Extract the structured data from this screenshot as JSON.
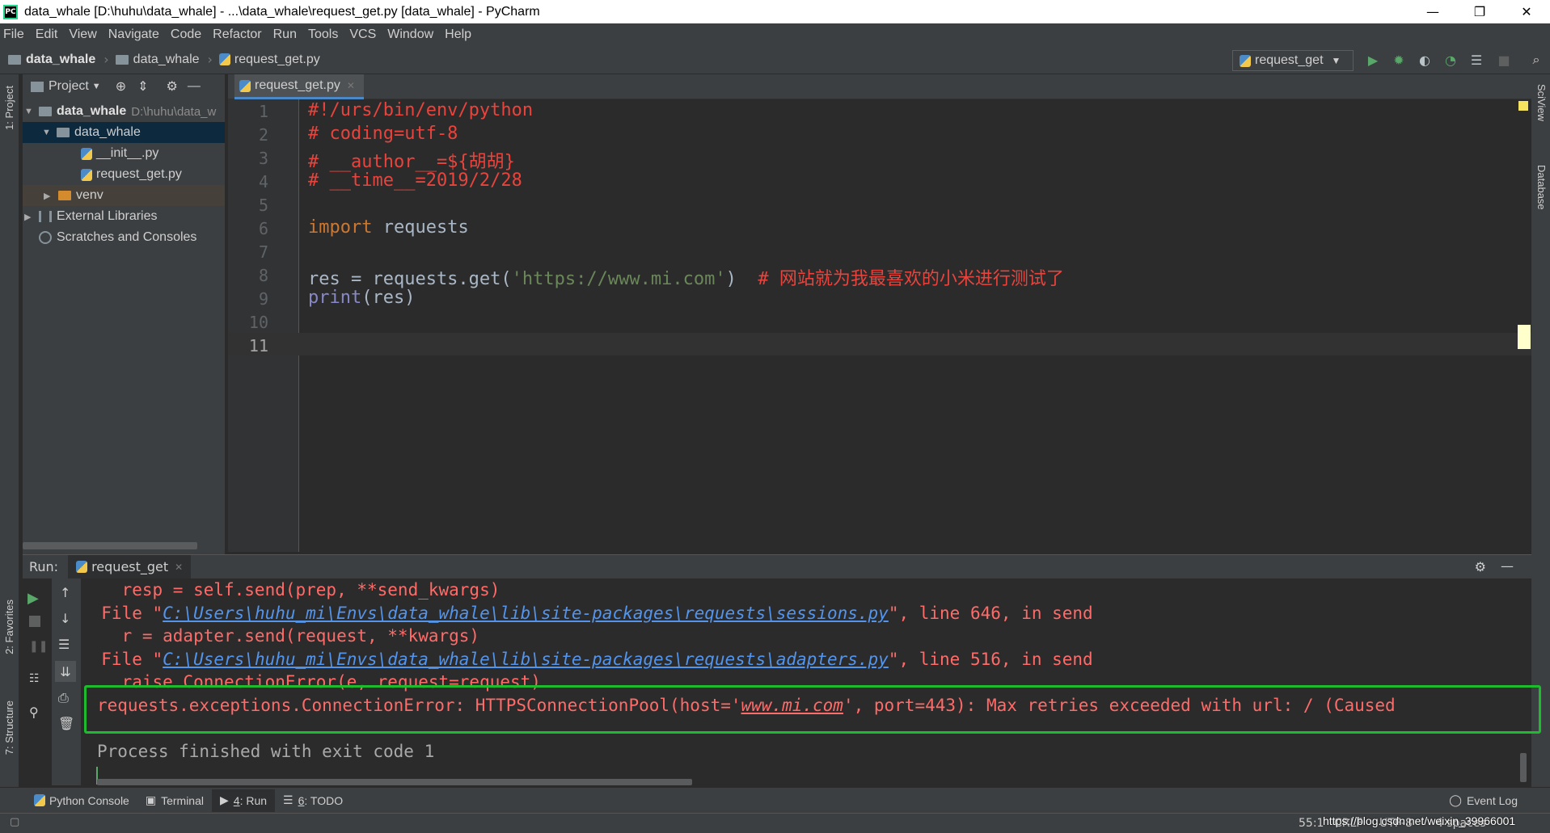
{
  "window": {
    "title": "data_whale [D:\\huhu\\data_whale] - ...\\data_whale\\request_get.py [data_whale] - PyCharm",
    "app_icon": "PC",
    "minimize": "—",
    "restore": "❐",
    "close": "✕"
  },
  "menu": [
    "File",
    "Edit",
    "View",
    "Navigate",
    "Code",
    "Refactor",
    "Run",
    "Tools",
    "VCS",
    "Window",
    "Help"
  ],
  "breadcrumb": {
    "root": "data_whale",
    "folder": "data_whale",
    "file": "request_get.py"
  },
  "toolbar": {
    "run_config": "request_get"
  },
  "left_strip": {
    "project": "1: Project",
    "favorites": "2: Favorites",
    "structure": "7: Structure"
  },
  "right_strip": {
    "sciview": "SciView",
    "database": "Database"
  },
  "project_panel": {
    "header": "Project",
    "tree": [
      {
        "label": "data_whale",
        "extra": "D:\\huhu\\data_w"
      },
      {
        "label": "data_whale"
      },
      {
        "label": "__init__.py"
      },
      {
        "label": "request_get.py"
      },
      {
        "label": "venv"
      },
      {
        "label": "External Libraries"
      },
      {
        "label": "Scratches and Consoles"
      }
    ]
  },
  "editor": {
    "tab": "request_get.py",
    "line_numbers": [
      "1",
      "2",
      "3",
      "4",
      "5",
      "6",
      "7",
      "8",
      "9",
      "10",
      "11"
    ],
    "code": {
      "l1": "#!/urs/bin/env/python",
      "l2": "# coding=utf-8",
      "l3": "# __author__=${胡胡}",
      "l4": "# __time__=2019/2/28",
      "l6_kw": "import",
      "l6_rest": " requests",
      "l8_a": "res = requests.get(",
      "l8_str": "'https://www.mi.com'",
      "l8_b": ")  ",
      "l8_comment": "# 网站就为我最喜欢的小米进行测试了",
      "l9_fn": "print",
      "l9_rest": "(res)"
    }
  },
  "run": {
    "label": "Run:",
    "tab": "request_get",
    "output": {
      "o1": "    resp = self.send(prep, **send_kwargs)",
      "o2_a": "  File \"",
      "o2_link": "C:\\Users\\huhu_mi\\Envs\\data_whale\\lib\\site-packages\\requests\\sessions.py",
      "o2_b": "\", line 646, in send",
      "o3": "    r = adapter.send(request, **kwargs)",
      "o4_a": "  File \"",
      "o4_link": "C:\\Users\\huhu_mi\\Envs\\data_whale\\lib\\site-packages\\requests\\adapters.py",
      "o4_b": "\", line 516, in send",
      "o5": "    raise ConnectionError(e, request=request)",
      "o6_a": "requests.exceptions.ConnectionError: HTTPSConnectionPool(host='",
      "o6_link": "www.mi.com",
      "o6_b": "', port=443): Max retries exceeded with url: / (Caused",
      "o7": "Process finished with exit code 1"
    }
  },
  "bottom_tabs": {
    "python_console": "Python Console",
    "terminal": "Terminal",
    "run_num": "4",
    "run": ": Run",
    "todo_num": "6",
    "todo": ": TODO",
    "event_log": "Event Log"
  },
  "status": {
    "position": "55:1",
    "line_sep": "CRLF",
    "encoding": "UTF-8",
    "indent": "4 spaces",
    "watermark": "https://blog.csdn.net/weixin_39966001"
  },
  "colors": {
    "comment_red": "#e8443d",
    "keyword": "#cc7832",
    "string": "#6a8759",
    "builtin": "#8888c6",
    "error": "#ff6b68",
    "highlight_box": "#1fbb2e",
    "run_green": "#59a869"
  }
}
